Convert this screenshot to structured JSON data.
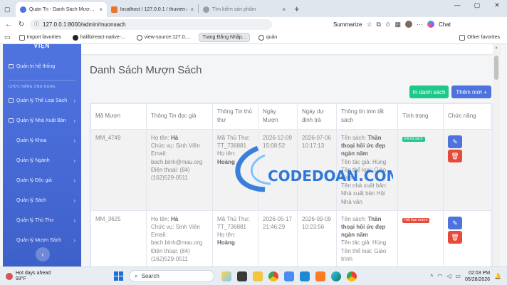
{
  "browser": {
    "tabs": [
      {
        "title": "Quản Trị - Danh Sách Mượn Sách",
        "active": true,
        "favicon_color": "#4e73df"
      },
      {
        "title": "localhost / 127.0.0.1 / thuvien / tai",
        "active": false,
        "favicon_color": "#e8762d"
      },
      {
        "title": "Tìm kiếm sản phẩm",
        "active": false,
        "favicon_color": "#9aa0a6"
      }
    ],
    "new_tab": "+",
    "url": "127.0.0.1:8000/admin/muonsach",
    "summarize": "Summarize",
    "chat": "Chat",
    "bookmarks": [
      {
        "label": "Import favorites",
        "highlight": false
      },
      {
        "label": "halilb/react-native-...",
        "highlight": false
      },
      {
        "label": "view-source:127.0....",
        "highlight": false
      },
      {
        "label": "Trang Đăng Nhập...",
        "highlight": true
      },
      {
        "label": "quản",
        "highlight": false
      }
    ],
    "other_favorites": "Other favorites"
  },
  "sidebar": {
    "brand": "VIỆN",
    "dashboard": "Quản trị hệ thống",
    "section_heading": "CHỨC NĂNG ỨNG DỤNG",
    "items": [
      "Quản lý Thể Loại Sách",
      "Quản lý Nhà Xuất Bản",
      "Quản lý Khoa",
      "Quản lý Ngành",
      "Quản lý Độc giả",
      "Quản lý Sách",
      "Quản lý Thủ Thư",
      "Quản lý Mượn Sách"
    ],
    "toggle_icon": "‹"
  },
  "main": {
    "title": "Danh Sách Mượn Sách",
    "print_button": "In danh sách",
    "add_button": "Thêm mới +",
    "table": {
      "headers": [
        "Mã Mượn",
        "Thông Tin đọc giả",
        "Thông Tin thủ thư",
        "Ngày Mượn",
        "Ngày dự định trả",
        "Thông tin tóm tắt sách",
        "Tình trạng",
        "Chức năng"
      ],
      "rows": [
        {
          "id": "MM_4749",
          "reader_name_label": "Họ tên:",
          "reader_name": "Hà",
          "reader_role": "Chức vụ: Sinh Viên",
          "reader_email_label": "Email:",
          "reader_email": "bach.binh@mau.org",
          "reader_phone": "Điện thoại: (84) (162)529-0511",
          "librarian_code": "Mã Thủ Thư: TT_736881",
          "librarian_name_label": "Họ tên:",
          "librarian_name": "Hoàng",
          "borrow_date": "2026-12-09 15:08:52",
          "due_date": "2026-07-06 10:17:13",
          "book_title_label": "Tên sách:",
          "book_title": "Thần thoại hồi ức đẹp ngàn năm",
          "book_author": "Tên tác giả: Hùng",
          "book_genre": "Tên thể loại: Giáo trình",
          "book_publisher": "Tên nhà xuất bản: Nhà xuất bản Hội Nhà văn",
          "status": "Đã trả sách",
          "status_color": "#1cc88a"
        },
        {
          "id": "MM_3625",
          "reader_name_label": "Họ tên:",
          "reader_name": "Hà",
          "reader_role": "Chức vụ: Sinh Viên",
          "reader_email_label": "Email:",
          "reader_email": "bach.binh@mau.org",
          "reader_phone": "Điện thoại: (84) (162)529-0511",
          "librarian_code": "Mã Thủ Thư: TT_736881",
          "librarian_name_label": "Họ tên:",
          "librarian_name": "Hoàng",
          "borrow_date": "2026-05-17 21:46:29",
          "due_date": "2026-09-09 10:23:56",
          "book_title_label": "Tên sách:",
          "book_title": "Thần thoại hồi ức đẹp ngàn năm",
          "book_author": "Tên tác giả: Hùng",
          "book_genre": "Tên thể loại: Giáo trình",
          "book_publisher": "",
          "status": "Hết hạn mượn",
          "status_color": "#e74a3b"
        }
      ]
    }
  },
  "watermark": "CODEDOAN.COM",
  "taskbar": {
    "weather_title": "Hot days ahead",
    "weather_temp": "93°F",
    "search_placeholder": "Search",
    "time": "02:03 PM",
    "date": "05/28/2026"
  },
  "colors": {
    "sidebar": "#4e73df",
    "success": "#1cc88a",
    "danger": "#e74a3b",
    "primary": "#4e73df"
  }
}
